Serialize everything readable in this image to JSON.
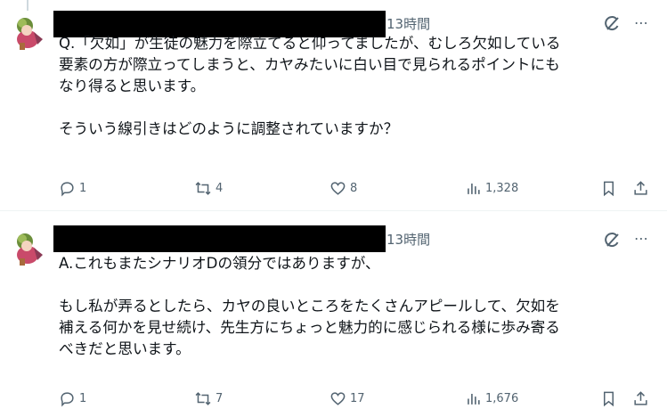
{
  "posts": [
    {
      "time": "13時間",
      "text_lines": [
        "Q.「欠如」が生徒の魅力を際立てると仰ってましたが、むしろ欠如している",
        "要素の方が際立ってしまうと、カヤみたいに白い目で見られるポイントにも",
        "なり得ると思います。",
        "",
        "そういう線引きはどのように調整されていますか？"
      ],
      "replies": "1",
      "reposts": "4",
      "likes": "8",
      "views": "1,328"
    },
    {
      "time": "13時間",
      "text_lines": [
        "A.これもまたシナリオDの領分ではありますが、",
        "",
        "もし私が弄るとしたら、カヤの良いところをたくさんアピールして、欠如を",
        "補える何かを見せ続け、先生方にちょっと魅力的に感じられる様に歩み寄る",
        "べきだと思います。"
      ],
      "replies": "1",
      "reposts": "7",
      "likes": "17",
      "views": "1,676"
    }
  ],
  "icons": {
    "more": "⋯",
    "grok": "grok-icon",
    "reply": "reply-icon",
    "repost": "repost-icon",
    "like": "heart-icon",
    "views": "views-icon",
    "bookmark": "bookmark-icon",
    "share": "share-icon"
  },
  "colors": {
    "text": "#0f1419",
    "secondary": "#536471",
    "divider": "#eff3f4"
  }
}
